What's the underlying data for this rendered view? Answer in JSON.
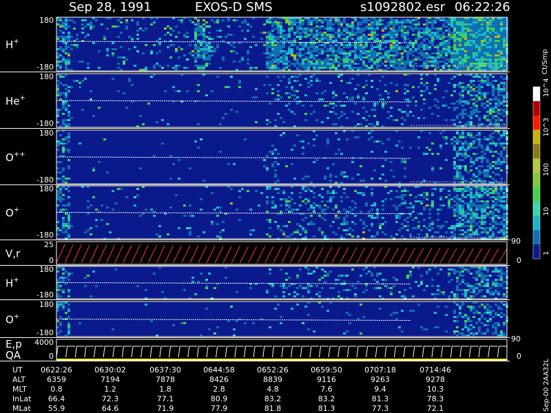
{
  "header": {
    "date": "Sep 28, 1991",
    "instrument": "EXOS-D SMS",
    "file": "s1092802.esr",
    "time": "06:22:26"
  },
  "colorbar": {
    "unit": "Ct/Smp",
    "tick_labels": [
      "1",
      "10",
      "100",
      "10^3",
      "10^4"
    ],
    "colors": [
      "#0a1a8c",
      "#0f6fb0",
      "#19b9c8",
      "#3ad7b0",
      "#44d24a",
      "#7fc93a",
      "#b6c83a",
      "#8a7a1c",
      "#c8b400",
      "#ff1a00",
      "#b00000",
      "#ffffff"
    ]
  },
  "side_text": "Sep-00  2AA32L",
  "chart_data": {
    "type": "heatmap",
    "panels": [
      {
        "label": "H",
        "charge": "+",
        "ylim": [
          -180,
          180
        ],
        "tick_top": "180",
        "tick_bottom": "-180"
      },
      {
        "label": "He",
        "charge": "+",
        "ylim": [
          -180,
          180
        ],
        "tick_top": "180",
        "tick_bottom": "-180"
      },
      {
        "label": "O",
        "charge": "++",
        "ylim": [
          -180,
          180
        ],
        "tick_top": "180",
        "tick_bottom": "-180"
      },
      {
        "label": "O",
        "charge": "+",
        "ylim": [
          -180,
          180
        ],
        "tick_top": "180",
        "tick_bottom": "-180"
      },
      {
        "label": "V,r",
        "charge": "",
        "ylim": [
          0,
          25
        ],
        "tick_top": "25",
        "tick_bottom": "0",
        "right_top": "90",
        "right_bottom": "0"
      },
      {
        "label": "H",
        "charge": "+",
        "ylim": [
          -180,
          180
        ],
        "tick_top": "180",
        "tick_bottom": "-180"
      },
      {
        "label": "O",
        "charge": "+",
        "ylim": [
          -180,
          180
        ],
        "tick_top": "180",
        "tick_bottom": "-180"
      },
      {
        "label": "E,p",
        "label2": "QA",
        "charge": "",
        "ylim": [
          0,
          4000
        ],
        "tick_top": "4000",
        "tick_bottom": "0",
        "right_top": "90",
        "right_bottom": "0"
      }
    ],
    "table": {
      "rows": [
        {
          "name": "UT",
          "values": [
            "0622:26",
            "0630:02",
            "0637:30",
            "0644:58",
            "0652:26",
            "0659:50",
            "0707:18",
            "0714:46"
          ]
        },
        {
          "name": "ALT",
          "values": [
            "6359",
            "7194",
            "7878",
            "8426",
            "8839",
            "9116",
            "9263",
            "9278"
          ]
        },
        {
          "name": "MLT",
          "values": [
            "0.8",
            "1.2",
            "1.8",
            "2.8",
            "4.8",
            "7.6",
            "9.4",
            "10.3"
          ]
        },
        {
          "name": "InLat",
          "values": [
            "66.4",
            "72.3",
            "77.1",
            "80.9",
            "83.2",
            "83.2",
            "81.3",
            "78.3"
          ]
        },
        {
          "name": "MLat",
          "values": [
            "55.9",
            "64.6",
            "71.9",
            "77.9",
            "81.8",
            "81.3",
            "77.3",
            "72.1"
          ]
        }
      ]
    }
  }
}
